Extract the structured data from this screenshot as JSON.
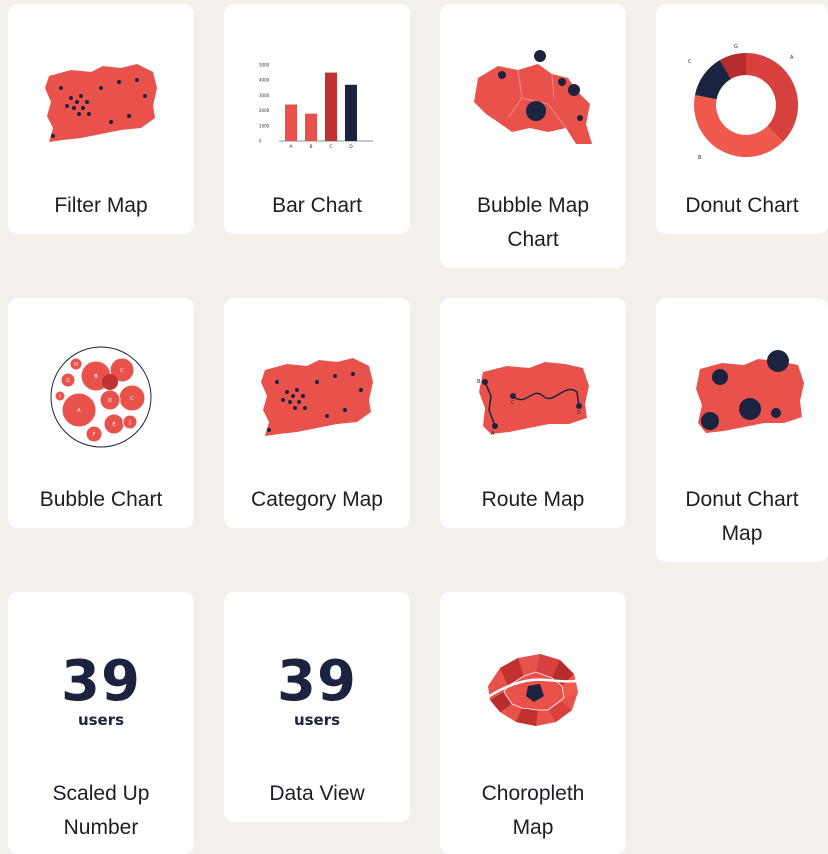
{
  "colors": {
    "background": "#f3efea",
    "card": "#ffffff",
    "accent_red": "#e8524a",
    "dark_red": "#c0312f",
    "navy": "#1c2340",
    "text": "#1c1d28"
  },
  "cards": [
    {
      "label": "Filter Map",
      "icon": "filter-map-icon"
    },
    {
      "label": "Bar Chart",
      "icon": "bar-chart-icon"
    },
    {
      "label": "Bubble Map\nChart",
      "icon": "bubble-map-chart-icon"
    },
    {
      "label": "Donut Chart",
      "icon": "donut-chart-icon"
    },
    {
      "label": "Bubble Chart",
      "icon": "bubble-chart-icon"
    },
    {
      "label": "Category Map",
      "icon": "category-map-icon"
    },
    {
      "label": "Route Map",
      "icon": "route-map-icon"
    },
    {
      "label": "Donut Chart\nMap",
      "icon": "donut-chart-map-icon"
    },
    {
      "label": "Scaled Up\nNumber",
      "icon": "scaled-up-number-icon",
      "number": "39",
      "unit": "users"
    },
    {
      "label": "Data View",
      "icon": "data-view-icon",
      "number": "39",
      "unit": "users"
    },
    {
      "label": "Choropleth\nMap",
      "icon": "choropleth-map-icon"
    }
  ],
  "bar_chart_thumb": {
    "categories": [
      "A",
      "B",
      "C",
      "D"
    ],
    "values": [
      2400,
      1800,
      4500,
      3700
    ],
    "y_ticks": [
      "5000",
      "4000",
      "3000",
      "2000",
      "1000",
      "0"
    ]
  },
  "donut_thumb": {
    "segment_labels": [
      "A",
      "B",
      "C",
      "G"
    ]
  },
  "bubble_chart_thumb": {
    "bubble_labels": [
      "A",
      "B",
      "C",
      "C",
      "D",
      "E",
      "F",
      "G",
      "H",
      "I",
      "J"
    ]
  },
  "route_thumb": {
    "stop_labels": [
      "A",
      "B",
      "C",
      "D"
    ]
  }
}
